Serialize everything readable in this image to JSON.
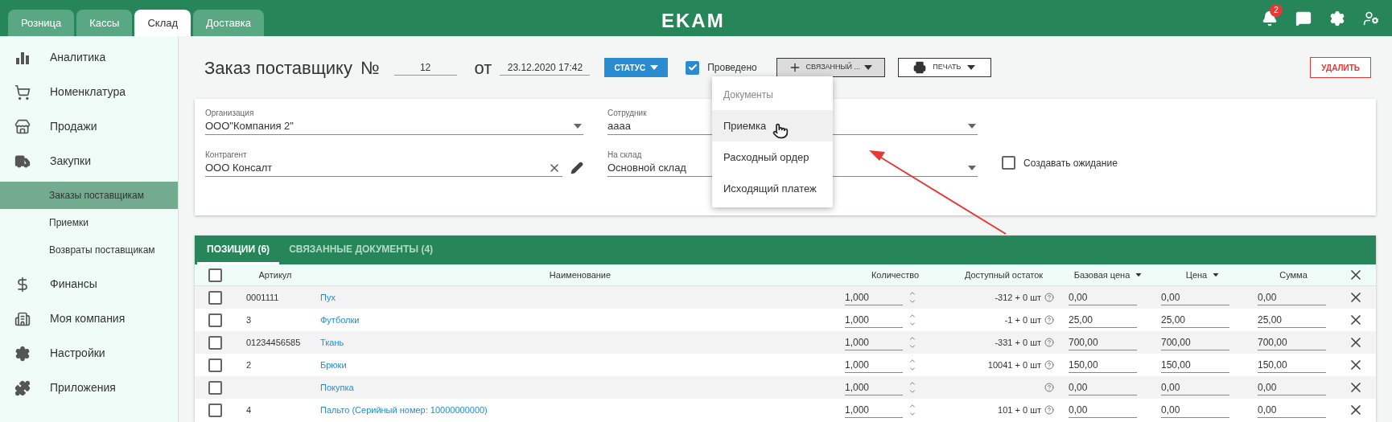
{
  "topbar": {
    "tabs": [
      {
        "label": "Розница",
        "selected": false
      },
      {
        "label": "Кассы",
        "selected": false
      },
      {
        "label": "Склад",
        "selected": true
      },
      {
        "label": "Доставка",
        "selected": false
      }
    ],
    "logo": "EKAM",
    "notifications": "2"
  },
  "sidebar": {
    "items": [
      {
        "label": "Аналитика"
      },
      {
        "label": "Номенклатура"
      },
      {
        "label": "Продажи"
      },
      {
        "label": "Закупки",
        "children": [
          {
            "label": "Заказы поставщикам",
            "selected": true
          },
          {
            "label": "Приемки",
            "selected": false
          },
          {
            "label": "Возвраты поставщикам",
            "selected": false
          }
        ]
      },
      {
        "label": "Финансы"
      },
      {
        "label": "Моя компания"
      },
      {
        "label": "Настройки"
      },
      {
        "label": "Приложения"
      }
    ]
  },
  "header": {
    "title": "Заказ поставщику",
    "number_label": "№",
    "number": "12",
    "date_label": "от",
    "date": "23.12.2020 17:42",
    "status_button": "СТАТУС",
    "posted": {
      "label": "Проведено",
      "checked": true
    },
    "related_button": {
      "label": "СВЯЗАННЫЙ ...",
      "open": true
    },
    "print_button": "ПЕЧАТЬ",
    "delete_button": "УДАЛИТЬ"
  },
  "form": {
    "fields": [
      {
        "label": "Организация",
        "value": "ООО\"Компания 2\"",
        "kind": "select"
      },
      {
        "label": "Сотрудник",
        "value": "аааа",
        "kind": "select"
      },
      {
        "label": "Контрагент",
        "value": "ООО Консалт",
        "kind": "entity"
      },
      {
        "label": "На склад",
        "value": "Основной склад",
        "kind": "select"
      }
    ],
    "wait_checkbox": {
      "label": "Создавать ожидание",
      "checked": false
    }
  },
  "related_menu": {
    "heading": "Документы",
    "items": [
      {
        "label": "Приемка",
        "highlighted": true
      },
      {
        "label": "Расходный ордер",
        "highlighted": false
      },
      {
        "label": "Исходящий платеж",
        "highlighted": false
      }
    ]
  },
  "table": {
    "tabs": [
      {
        "label": "ПОЗИЦИИ (6)",
        "selected": true
      },
      {
        "label": "СВЯЗАННЫЕ ДОКУМЕНТЫ (4)",
        "selected": false
      }
    ],
    "select_all_checked": false,
    "columns": [
      {
        "label": "Артикул",
        "sortable": false
      },
      {
        "label": "Наименование",
        "sortable": false
      },
      {
        "label": "Количество",
        "sortable": false
      },
      {
        "label": "Доступный остаток",
        "sortable": false
      },
      {
        "label": "Базовая цена",
        "sortable": true
      },
      {
        "label": "Цена",
        "sortable": true
      },
      {
        "label": "Сумма",
        "sortable": false
      }
    ],
    "rows": [
      {
        "article": "0001111",
        "name": "Пух",
        "qty": "1,000",
        "stock": "-312 + 0 шт",
        "base": "0,00",
        "price": "0,00",
        "sum": "0,00",
        "checked": false
      },
      {
        "article": "3",
        "name": "Футболки",
        "qty": "1,000",
        "stock": "-1 + 0 шт",
        "base": "25,00",
        "price": "25,00",
        "sum": "25,00",
        "checked": false
      },
      {
        "article": "01234456585",
        "name": "Ткань",
        "qty": "1,000",
        "stock": "-331 + 0 шт",
        "base": "700,00",
        "price": "700,00",
        "sum": "700,00",
        "checked": false
      },
      {
        "article": "2",
        "name": "Брюки",
        "qty": "1,000",
        "stock": "10041 + 0 шт",
        "base": "150,00",
        "price": "150,00",
        "sum": "150,00",
        "checked": false
      },
      {
        "name": "Покупка",
        "qty": "1,000",
        "base": "0,00",
        "price": "0,00",
        "sum": "0,00",
        "checked": false
      },
      {
        "article": "4",
        "name": "Пальто (Серийный номер: 10000000000)",
        "qty": "1,000",
        "stock": "101 + 0 шт",
        "base": "0,00",
        "price": "0,00",
        "sum": "0,00",
        "checked": false
      }
    ]
  }
}
